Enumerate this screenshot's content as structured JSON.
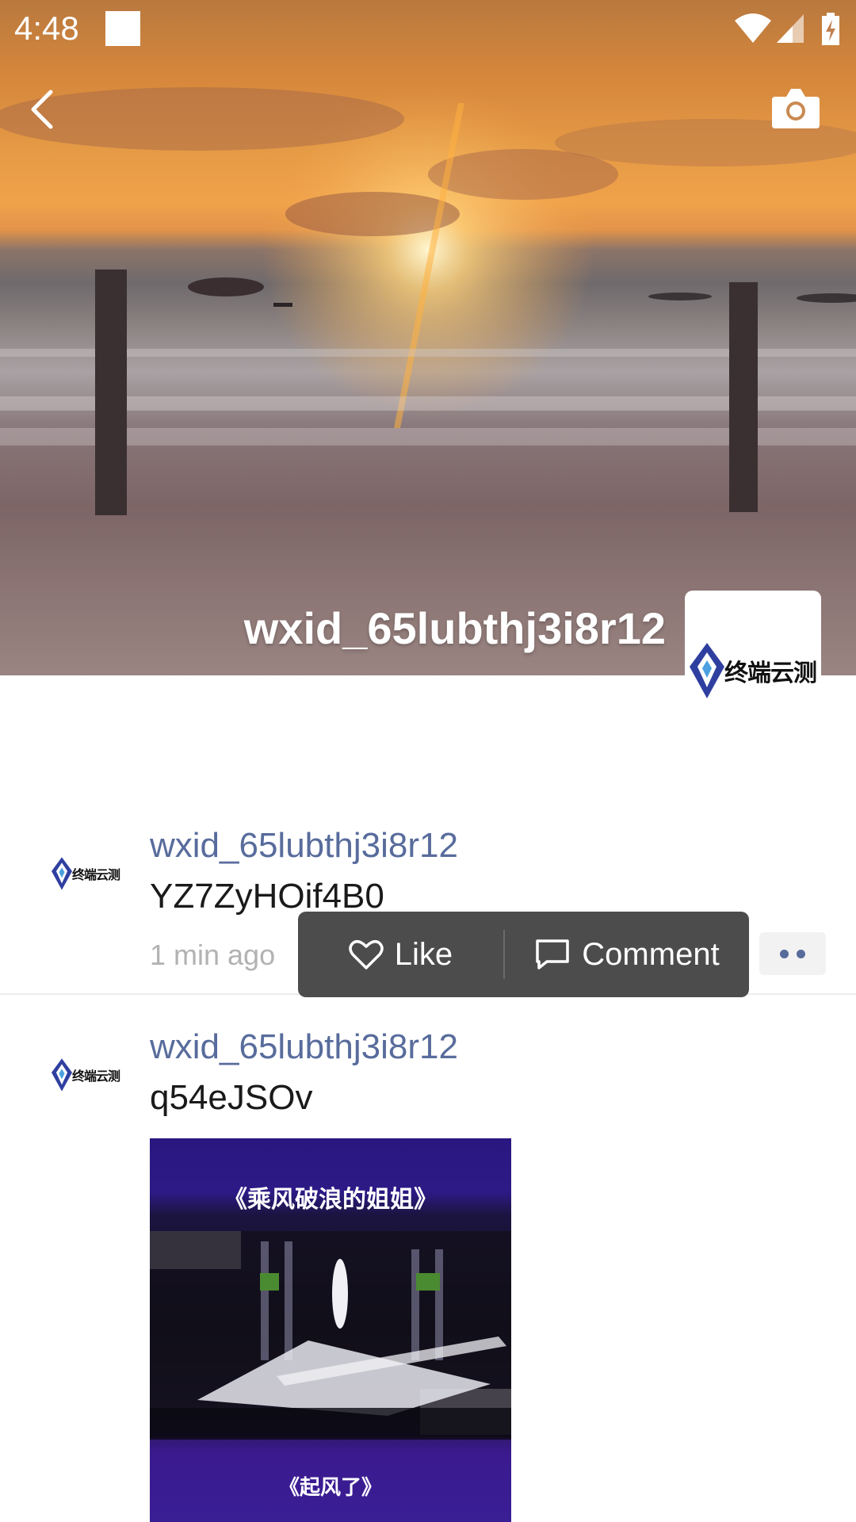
{
  "status_bar": {
    "time": "4:48"
  },
  "cover": {
    "username": "wxid_65lubthj3i8r12",
    "avatar_logo_text": "终端云测"
  },
  "icons": {
    "back": "chevron-left-icon",
    "camera": "camera-icon",
    "like": "heart-outline-icon",
    "comment": "comment-bubble-icon",
    "more": "more-dots-icon"
  },
  "colors": {
    "name_link": "#586c9c",
    "action_bar_bg": "#4c4c4c",
    "time_text": "#b2b2b2"
  },
  "posts": [
    {
      "name": "wxid_65lubthj3i8r12",
      "text": "YZ7ZyHOif4B0",
      "time": "1 min ago",
      "avatar_logo_text": "终端云测"
    },
    {
      "name": "wxid_65lubthj3i8r12",
      "text": "q54eJSOv",
      "avatar_logo_text": "终端云测",
      "media": {
        "caption_top": "《乘风破浪的姐姐》",
        "caption_bottom": "《起风了》"
      }
    }
  ],
  "action_bar": {
    "like_label": "Like",
    "comment_label": "Comment"
  }
}
